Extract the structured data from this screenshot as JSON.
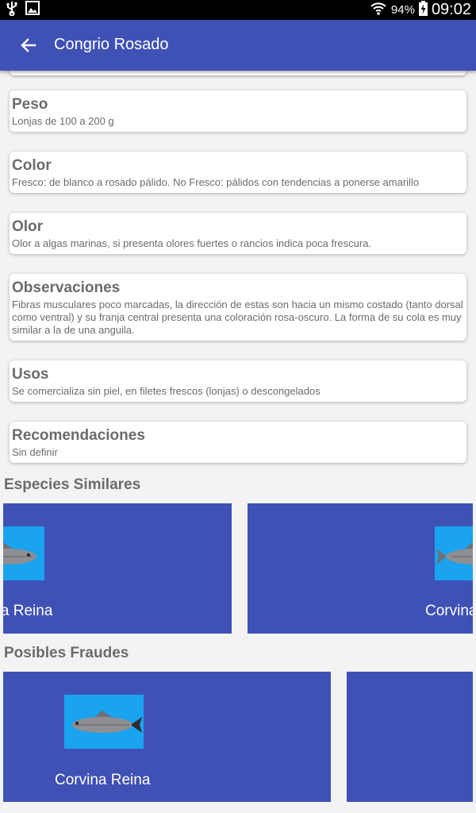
{
  "status_bar": {
    "battery_percent": "94%",
    "time": "09:02",
    "icons": [
      "usb-icon",
      "image-icon",
      "wifi-icon",
      "battery-charging-icon"
    ]
  },
  "appbar": {
    "title": "Congrio Rosado",
    "back_icon": "arrow-back-icon"
  },
  "cards": [
    {
      "title": "Peso",
      "body": "Lonjas de 100 a 200 g"
    },
    {
      "title": "Color",
      "body": "Fresco: de blanco a rosado pálido. No Fresco: pálidos con tendencias a ponerse amarillo"
    },
    {
      "title": "Olor",
      "body": "Olor a algas marinas, si presenta olores fuertes o rancios indica poca frescura."
    },
    {
      "title": "Observaciones",
      "body": "Fibras musculares poco marcadas, la dirección de estas son hacia un mismo costado (tanto dorsal como ventral) y su franja central presenta una coloración rosa-oscuro. La forma de su cola es muy similar a la de una anguila."
    },
    {
      "title": "Usos",
      "body": "Se comercializa sin piel, en filetes frescos (lonjas) o descongelados"
    },
    {
      "title": "Recomendaciones",
      "body": "Sin definir"
    }
  ],
  "similar": {
    "title": "Especies Similares",
    "items": [
      {
        "label": "Corvina Reina"
      },
      {
        "label": "Corvina Reina"
      }
    ]
  },
  "frauds": {
    "title": "Posibles Fraudes",
    "items": [
      {
        "label": "Corvina Reina"
      },
      {
        "label": ""
      }
    ]
  },
  "colors": {
    "primary": "#3f51b5",
    "image_bg": "#1aa3ef",
    "text": "#6b6b6b"
  }
}
